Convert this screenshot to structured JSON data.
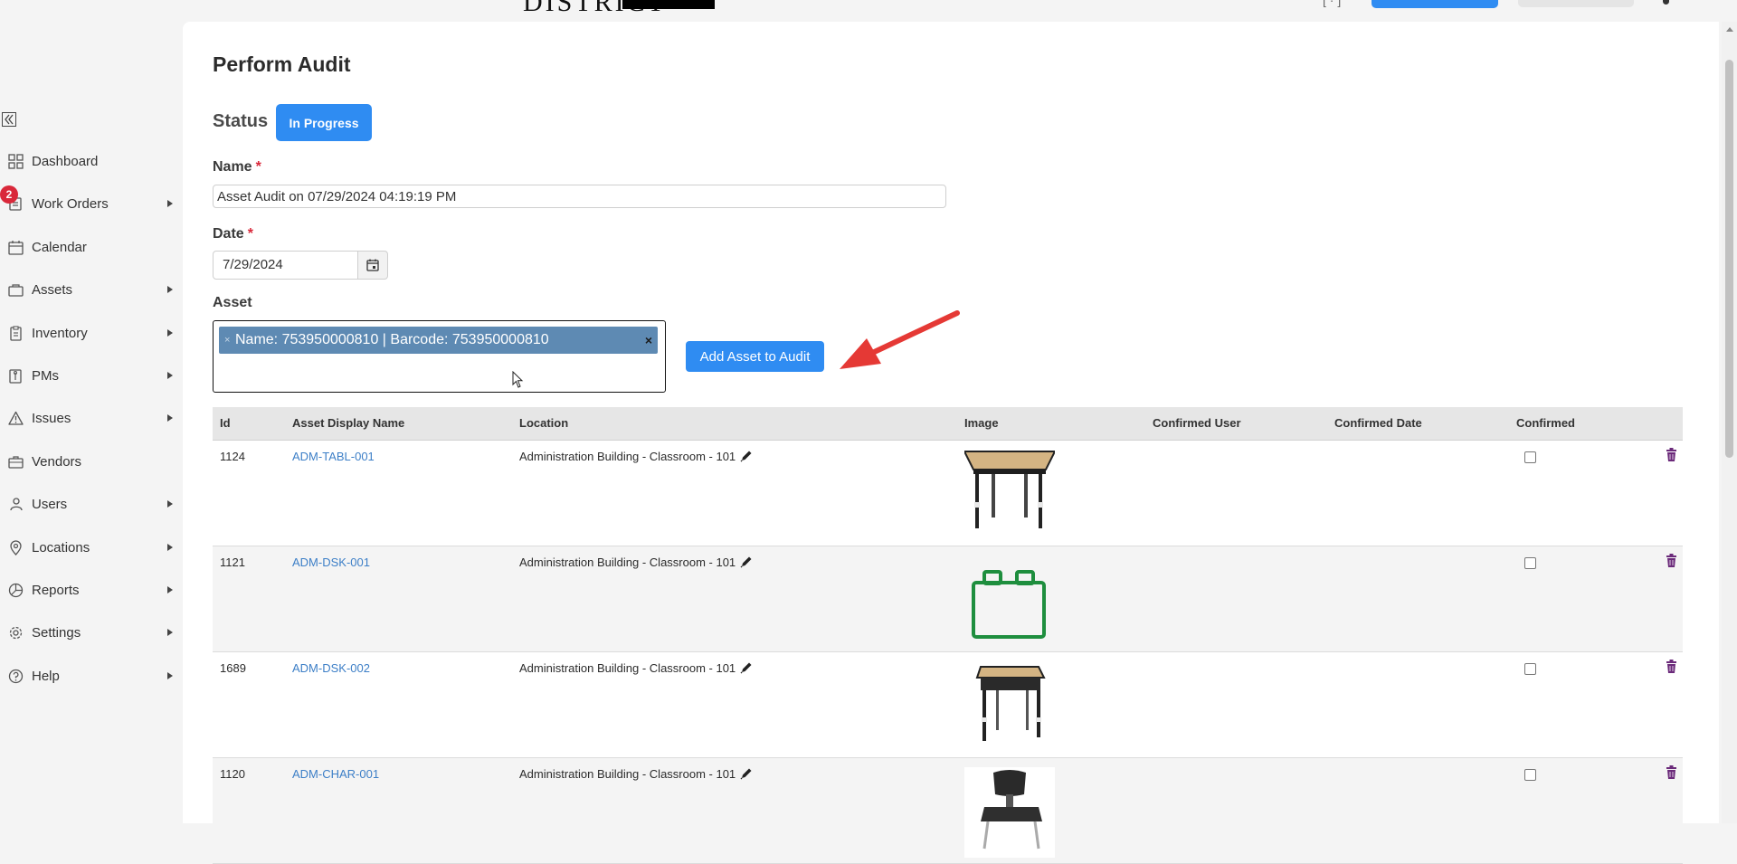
{
  "header": {
    "logo_text": "DISTRICT",
    "bracket_text": "[ · ]"
  },
  "sidebar": {
    "items": [
      {
        "label": "Dashboard",
        "icon": "dashboard-icon",
        "has_submenu": false
      },
      {
        "label": "Work Orders",
        "icon": "work-orders-icon",
        "has_submenu": true,
        "badge": "2"
      },
      {
        "label": "Calendar",
        "icon": "calendar-icon",
        "has_submenu": false
      },
      {
        "label": "Assets",
        "icon": "assets-icon",
        "has_submenu": true
      },
      {
        "label": "Inventory",
        "icon": "inventory-icon",
        "has_submenu": true
      },
      {
        "label": "PMs",
        "icon": "pms-icon",
        "has_submenu": true
      },
      {
        "label": "Issues",
        "icon": "warning-icon",
        "has_submenu": true
      },
      {
        "label": "Vendors",
        "icon": "briefcase-icon",
        "has_submenu": false
      },
      {
        "label": "Users",
        "icon": "users-icon",
        "has_submenu": true
      },
      {
        "label": "Locations",
        "icon": "location-pin-icon",
        "has_submenu": true
      },
      {
        "label": "Reports",
        "icon": "pie-chart-icon",
        "has_submenu": true
      },
      {
        "label": "Settings",
        "icon": "gear-icon",
        "has_submenu": true
      },
      {
        "label": "Help",
        "icon": "help-icon",
        "has_submenu": true
      }
    ]
  },
  "page": {
    "title": "Perform Audit",
    "status_label": "Status",
    "status_value": "In Progress",
    "name_label": "Name",
    "name_value": "Asset Audit on 07/29/2024 04:19:19 PM",
    "date_label": "Date",
    "date_value": "7/29/2024",
    "asset_label": "Asset",
    "asset_chip": "Name: 753950000810 | Barcode: 753950000810",
    "chip_remove_small": "×",
    "chip_remove": "×",
    "required_mark": "*",
    "add_button": "Add Asset to Audit"
  },
  "table": {
    "headers": [
      "Id",
      "Asset Display Name",
      "Location",
      "Image",
      "Confirmed User",
      "Confirmed Date",
      "Confirmed"
    ],
    "rows": [
      {
        "id": "1124",
        "name": "ADM-TABL-001",
        "location": "Administration Building - Classroom - 101",
        "image": "table-image",
        "confirmed_user": "",
        "confirmed_date": "",
        "confirmed": false
      },
      {
        "id": "1121",
        "name": "ADM-DSK-001",
        "location": "Administration Building - Classroom - 101",
        "image": "placeholder-asset-icon",
        "confirmed_user": "",
        "confirmed_date": "",
        "confirmed": false
      },
      {
        "id": "1689",
        "name": "ADM-DSK-002",
        "location": "Administration Building - Classroom - 101",
        "image": "desk-image",
        "confirmed_user": "",
        "confirmed_date": "",
        "confirmed": false
      },
      {
        "id": "1120",
        "name": "ADM-CHAR-001",
        "location": "Administration Building - Classroom - 101",
        "image": "chair-image",
        "confirmed_user": "",
        "confirmed_date": "",
        "confirmed": false
      }
    ]
  },
  "colors": {
    "primary": "#2f8cf2",
    "chip": "#5e8ab3",
    "badge": "#d9283a",
    "link": "#3d7fc7",
    "arrow": "#e53935",
    "placeholder_icon": "#1e8e3e"
  }
}
